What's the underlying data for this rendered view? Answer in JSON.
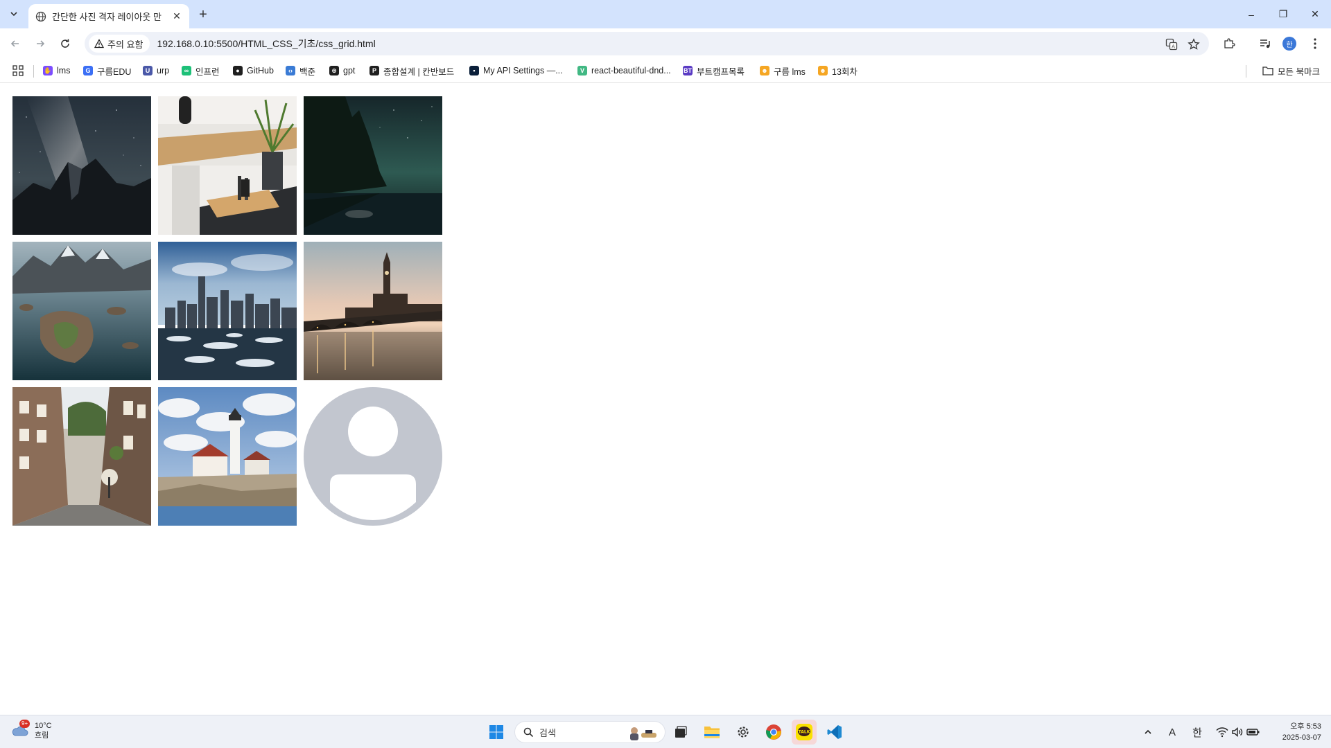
{
  "browser": {
    "tab": {
      "title": "간단한 사진 격자 레이아웃 만",
      "close": "✕"
    },
    "new_tab": "+",
    "window": {
      "minimize": "–",
      "maximize": "❐",
      "close": "✕"
    },
    "security_chip": "주의 요함",
    "url": "192.168.0.10:5500/HTML_CSS_기초/css_grid.html",
    "profile_initial": "한"
  },
  "bookmarks": {
    "items": [
      {
        "label": "lms",
        "icon": "lms-icon",
        "color": "#7c4dff"
      },
      {
        "label": "구름EDU",
        "icon": "goorm-edu-icon",
        "color": "#3b6ff5"
      },
      {
        "label": "urp",
        "icon": "urp-icon",
        "color": "#4a58a8"
      },
      {
        "label": "인프런",
        "icon": "inflearn-icon",
        "color": "#1dc078"
      },
      {
        "label": "GitHub",
        "icon": "github-icon",
        "color": "#1f1f1f"
      },
      {
        "label": "백준",
        "icon": "baekjoon-icon",
        "color": "#3a7bd5"
      },
      {
        "label": "gpt",
        "icon": "openai-icon",
        "color": "#1f1f1f"
      },
      {
        "label": "종합설계 | 칸반보드",
        "icon": "project-icon",
        "color": "#1f1f1f"
      },
      {
        "label": "My API Settings —...",
        "icon": "api-icon",
        "color": "#0b1f3a"
      },
      {
        "label": "react-beautiful-dnd...",
        "icon": "vue-icon",
        "color": "#41b883"
      },
      {
        "label": "부트캠프목록",
        "icon": "bootcamp-icon",
        "color": "#5b3cc4"
      },
      {
        "label": "구름 lms",
        "icon": "goorm-lms-icon",
        "color": "#f5a623"
      },
      {
        "label": "13회차",
        "icon": "goorm-lms-icon-2",
        "color": "#f5a623"
      }
    ],
    "all_bookmarks": "모든 북마크"
  },
  "gallery": {
    "images": [
      {
        "name": "milky-way-mountain"
      },
      {
        "name": "wooden-desk-plant"
      },
      {
        "name": "night-lake-forest"
      },
      {
        "name": "island-village-aerial"
      },
      {
        "name": "city-skyline-ice"
      },
      {
        "name": "westminster-bridge-sunset"
      },
      {
        "name": "old-town-street"
      },
      {
        "name": "lighthouse-coast"
      },
      {
        "name": "placeholder-avatar"
      }
    ]
  },
  "taskbar": {
    "weather": {
      "temp": "10°C",
      "condition": "흐림",
      "badge": "9+"
    },
    "search_placeholder": "검색",
    "tray": {
      "language": "A",
      "ime": "한"
    },
    "clock": {
      "time": "오후 5:53",
      "date": "2025-03-07"
    }
  }
}
